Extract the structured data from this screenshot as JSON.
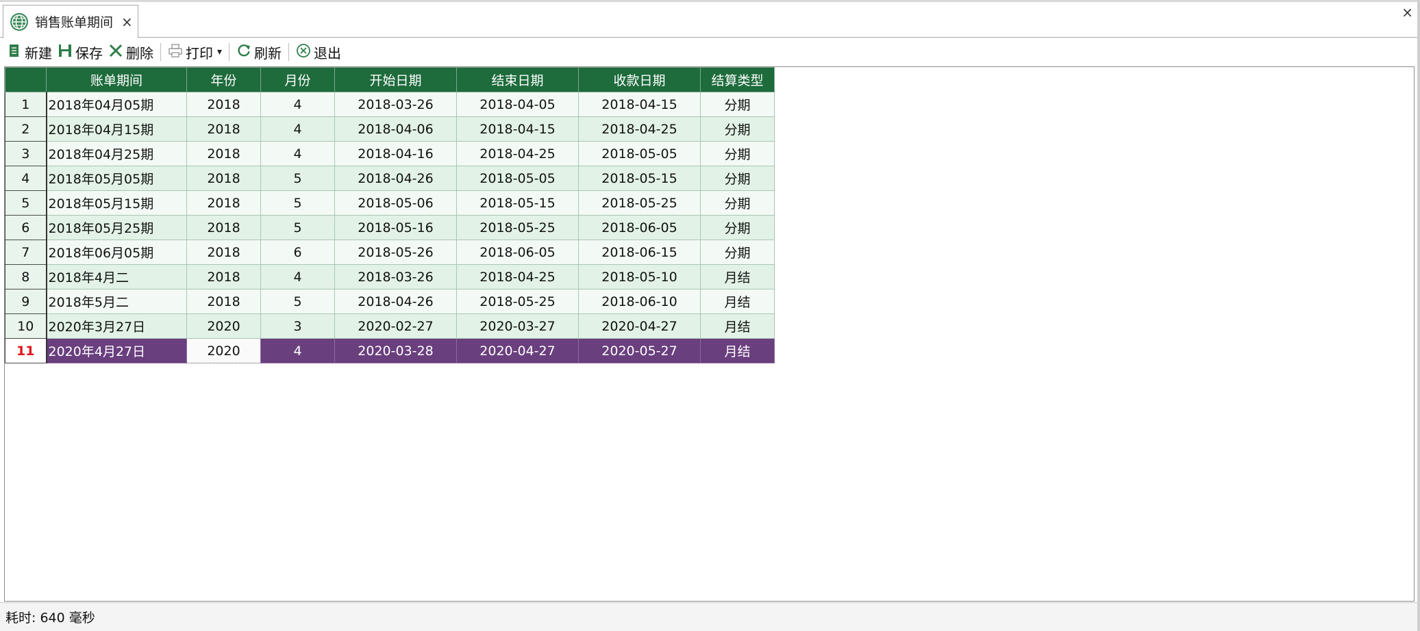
{
  "tab": {
    "title": "销售账单期间",
    "close": "×"
  },
  "window": {
    "close": "×"
  },
  "toolbar": {
    "new_label": "新建",
    "save_label": "保存",
    "delete_label": "删除",
    "print_label": "打印",
    "print_caret": "▾",
    "refresh_label": "刷新",
    "exit_label": "退出"
  },
  "grid": {
    "columns": [
      "账单期间",
      "年份",
      "月份",
      "开始日期",
      "结束日期",
      "收款日期",
      "结算类型"
    ],
    "rows": [
      [
        "1",
        "2018年04月05期",
        "2018",
        "4",
        "2018-03-26",
        "2018-04-05",
        "2018-04-15",
        "分期"
      ],
      [
        "2",
        "2018年04月15期",
        "2018",
        "4",
        "2018-04-06",
        "2018-04-15",
        "2018-04-25",
        "分期"
      ],
      [
        "3",
        "2018年04月25期",
        "2018",
        "4",
        "2018-04-16",
        "2018-04-25",
        "2018-05-05",
        "分期"
      ],
      [
        "4",
        "2018年05月05期",
        "2018",
        "5",
        "2018-04-26",
        "2018-05-05",
        "2018-05-15",
        "分期"
      ],
      [
        "5",
        "2018年05月15期",
        "2018",
        "5",
        "2018-05-06",
        "2018-05-15",
        "2018-05-25",
        "分期"
      ],
      [
        "6",
        "2018年05月25期",
        "2018",
        "5",
        "2018-05-16",
        "2018-05-25",
        "2018-06-05",
        "分期"
      ],
      [
        "7",
        "2018年06月05期",
        "2018",
        "6",
        "2018-05-26",
        "2018-06-05",
        "2018-06-15",
        "分期"
      ],
      [
        "8",
        "2018年4月二",
        "2018",
        "4",
        "2018-03-26",
        "2018-04-25",
        "2018-05-10",
        "月结"
      ],
      [
        "9",
        "2018年5月二",
        "2018",
        "5",
        "2018-04-26",
        "2018-05-25",
        "2018-06-10",
        "月结"
      ],
      [
        "10",
        "2020年3月27日",
        "2020",
        "3",
        "2020-02-27",
        "2020-03-27",
        "2020-04-27",
        "月结"
      ],
      [
        "11",
        "2020年4月27日",
        "2020",
        "4",
        "2020-03-28",
        "2020-04-27",
        "2020-05-27",
        "月结"
      ]
    ],
    "selected_row": 11
  },
  "status": {
    "text": "耗时: 640 毫秒"
  },
  "colors": {
    "header_bg": "#1e6b3c",
    "selected_bg": "#6a3f7e",
    "row_alt_bg": "#e2f2e6"
  }
}
